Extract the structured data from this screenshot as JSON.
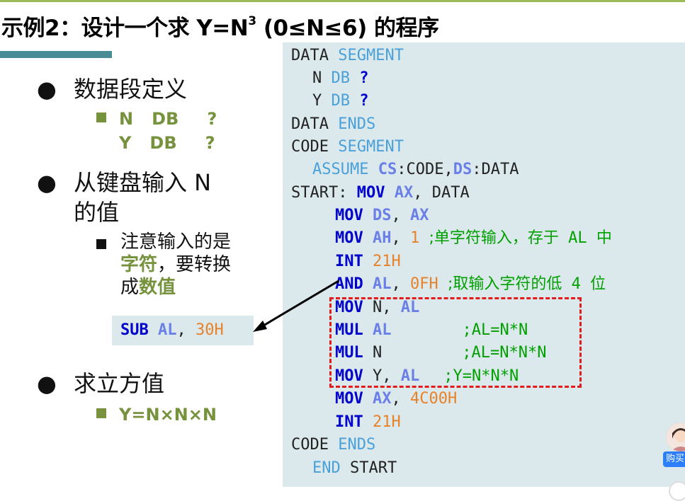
{
  "title": {
    "prefix": "示例2：设计一个求 Y=N",
    "superscript": "3",
    "suffix": " (0≤N≤6) 的程序"
  },
  "bullets": [
    {
      "symbol": "●",
      "text_line1": "数据段定义",
      "text_line2": ""
    },
    {
      "symbol": "●",
      "text_line1": "从键盘输入 N",
      "text_line2": "的值"
    },
    {
      "symbol": "●",
      "text_line1": "求立方值",
      "text_line2": ""
    }
  ],
  "data_def": [
    {
      "name": "N",
      "type": "DB",
      "value": "?"
    },
    {
      "name": "Y",
      "type": "DB",
      "value": "?"
    }
  ],
  "input_note": {
    "part1": "注意输入的是",
    "highlight1": "字符",
    "part2": "，要转换",
    "part3": "成",
    "highlight2": "数值"
  },
  "sub_instruction": {
    "op": "SUB",
    "reg": "AL",
    "sep": ",",
    "val": "30H"
  },
  "cube_formula": "Y=N×N×N",
  "code": {
    "l1_name": "DATA",
    "l1_dir": "SEGMENT",
    "l2_var": "N",
    "l2_type": "DB",
    "l2_val": "?",
    "l3_var": "Y",
    "l3_type": "DB",
    "l3_val": "?",
    "l4_name": "DATA",
    "l4_dir": "ENDS",
    "l5_name": "CODE",
    "l5_dir": "SEGMENT",
    "l6_dir": "ASSUME",
    "l6_r1": "CS",
    "l6_c1": ":CODE,",
    "l6_r2": "DS",
    "l6_c2": ":DATA",
    "l7_label": "START:",
    "l7_op": "MOV",
    "l7_r": "AX",
    "l7_rest": ", DATA",
    "l8_op": "MOV",
    "l8_r1": "DS",
    "l8_sep": ",",
    "l8_r2": "AX",
    "l9_op": "MOV",
    "l9_r": "AH",
    "l9_sep": ",",
    "l9_num": "1",
    "l9_c1": ";单字符输入，存于",
    "l9_c2": "AL",
    "l9_c3": "中",
    "l10_op": "INT",
    "l10_num": "21H",
    "l11_op": "AND",
    "l11_r": "AL",
    "l11_sep": ",",
    "l11_num": "0FH",
    "l11_c1": ";取输入字符的低",
    "l11_c2": "4",
    "l11_c3": "位",
    "l12_op": "MOV",
    "l12_a": "N,",
    "l12_r": "AL",
    "l13_op": "MUL",
    "l13_r": "AL",
    "l13_cmt": ";AL=N*N",
    "l14_op": "MUL",
    "l14_a": "N",
    "l14_cmt": ";AL=N*N*N",
    "l15_op": "MOV",
    "l15_a": "Y,",
    "l15_r": "AL",
    "l15_cmt": ";Y=N*N*N",
    "l16_op": "MOV",
    "l16_r": "AX",
    "l16_sep": ",",
    "l16_num": "4C00H",
    "l17_op": "INT",
    "l17_num": "21H",
    "l18_name": "CODE",
    "l18_dir": "ENDS",
    "l19_dir": "END",
    "l19_label": "START"
  },
  "floating_widget": {
    "buy_label": "购买"
  },
  "colors": {
    "accent_green": "#76923c",
    "keyword_blue": "#0000cc",
    "register_blue": "#6a7fe8",
    "directive_blue": "#4aa0d8",
    "number_orange": "#e8822a",
    "comment_green": "#00a000",
    "highlight_box_red": "#e21c1c",
    "code_panel_bg": "#dbe9ec"
  }
}
